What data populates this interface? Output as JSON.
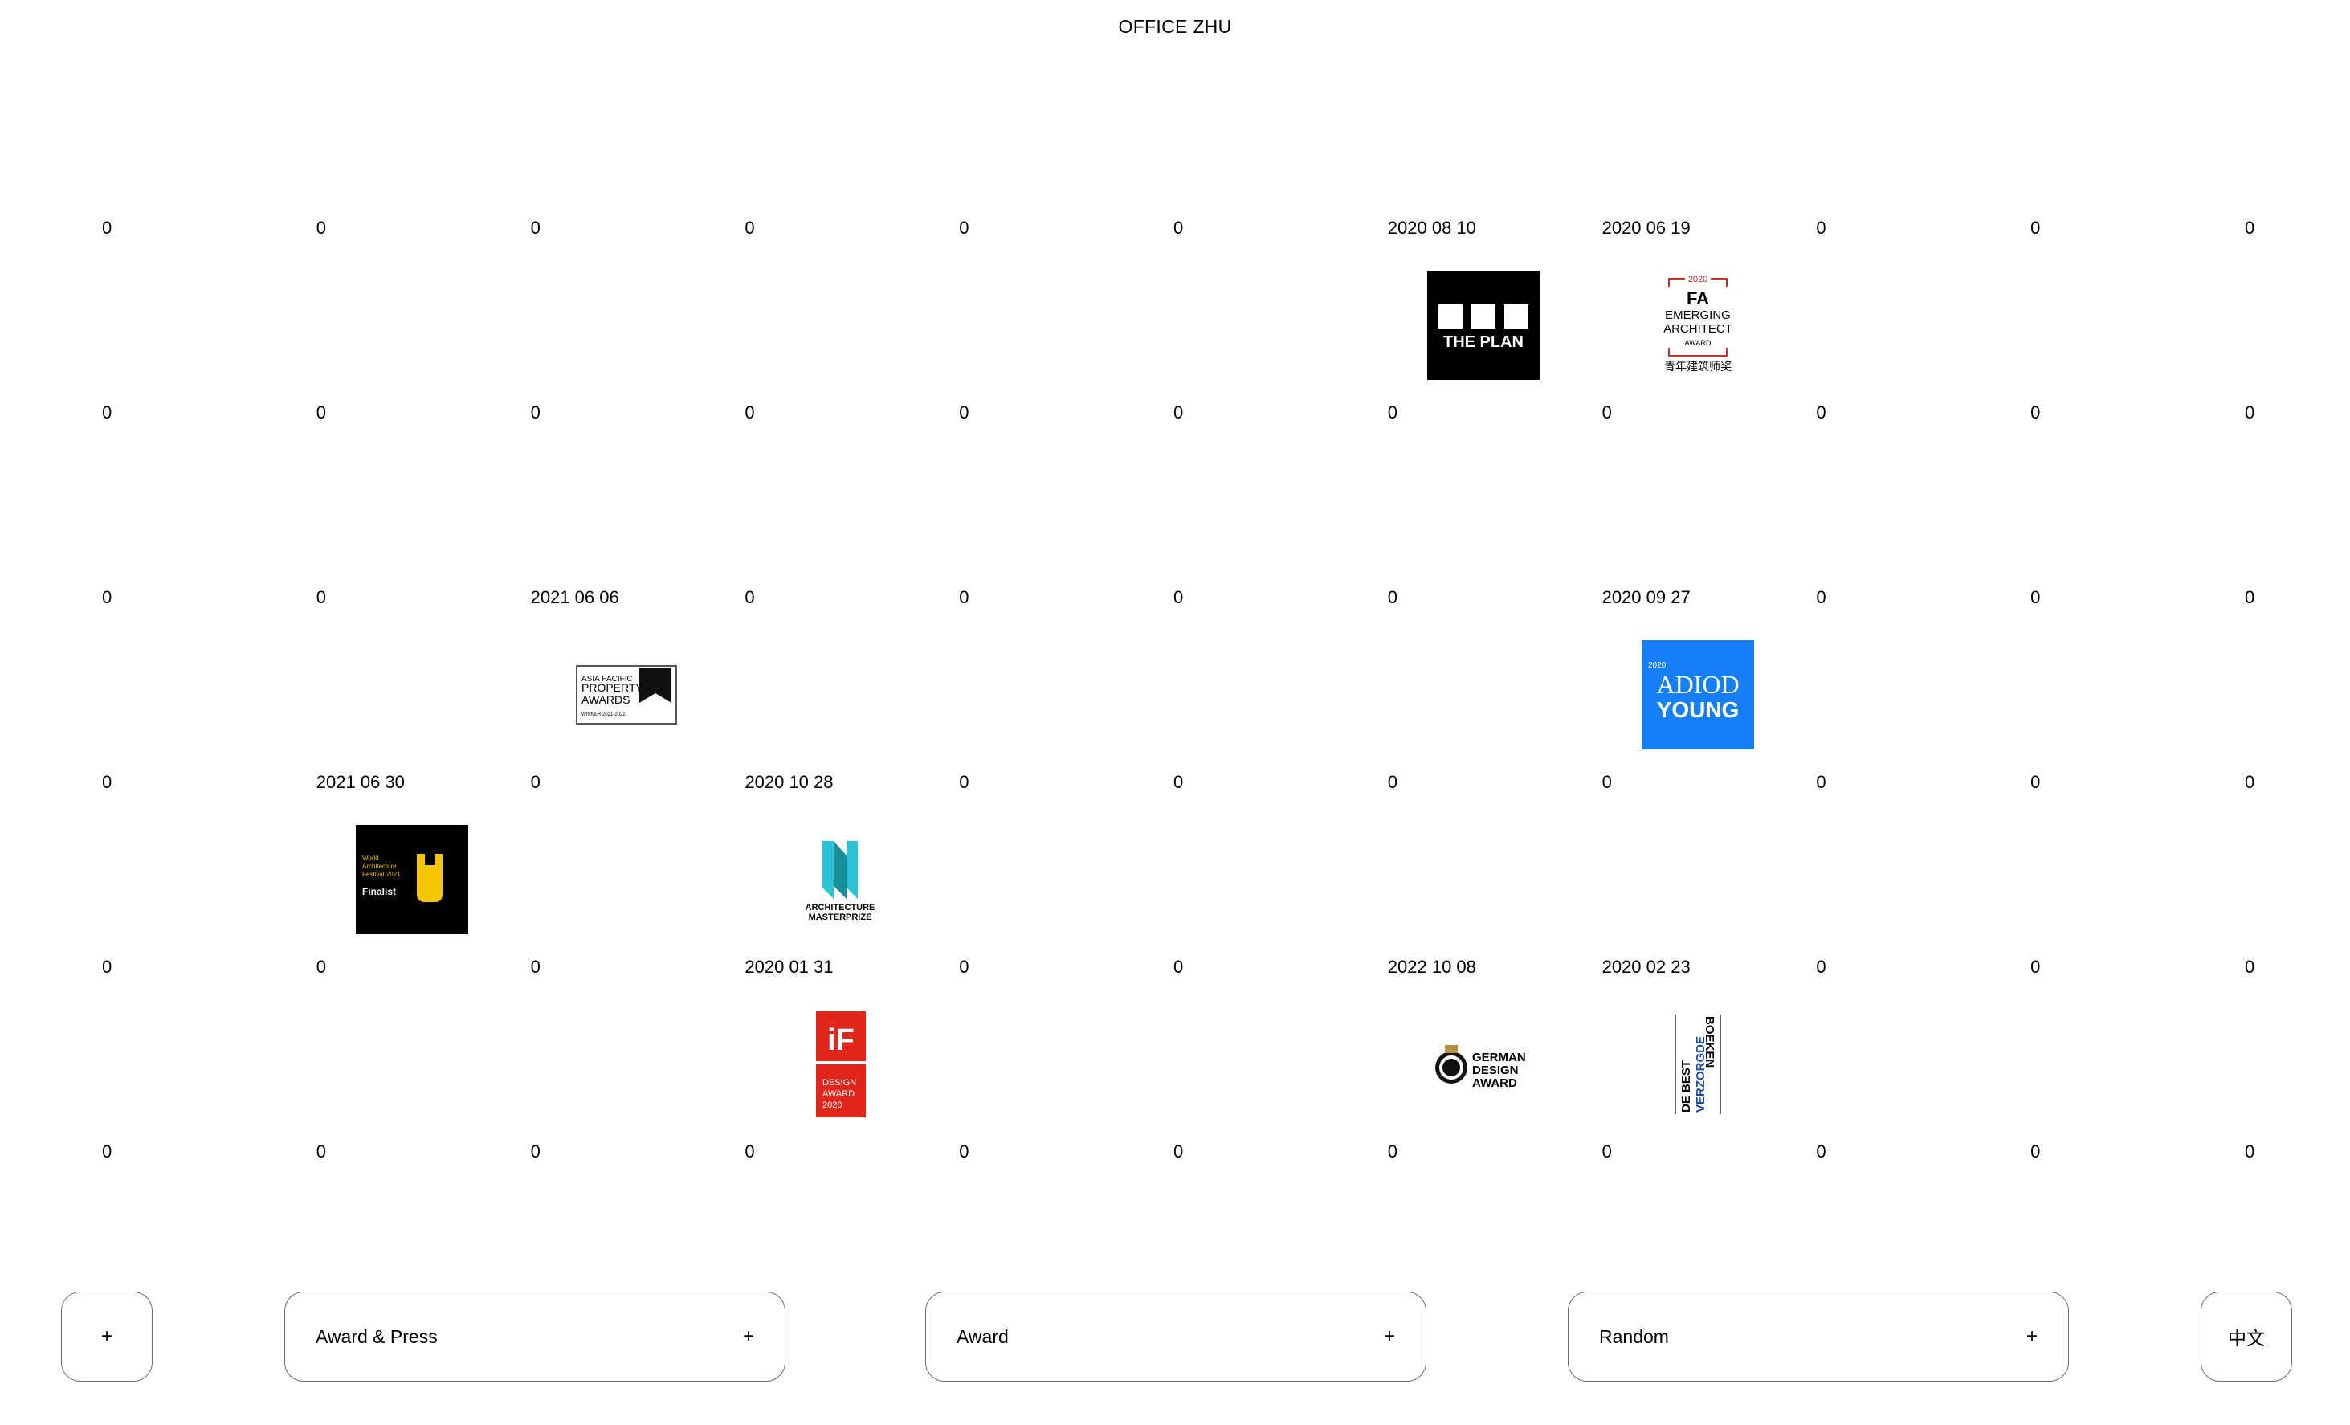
{
  "header": {
    "title": "OFFICE ZHU"
  },
  "grid": {
    "rows": [
      [
        "0",
        "0",
        "0",
        "0",
        "0",
        "0",
        "2020 08 10",
        "2020 06 19",
        "0",
        "0",
        "0"
      ],
      [
        "0",
        "0",
        "0",
        "0",
        "0",
        "0",
        "0",
        "0",
        "0",
        "0",
        "0"
      ],
      [
        "0",
        "0",
        "2021 06 06",
        "0",
        "0",
        "0",
        "0",
        "2020 09 27",
        "0",
        "0",
        "0"
      ],
      [
        "0",
        "2021 06 30",
        "0",
        "2020 10 28",
        "0",
        "0",
        "0",
        "0",
        "0",
        "0",
        "0"
      ],
      [
        "0",
        "0",
        "0",
        "2020 01 31",
        "0",
        "0",
        "2022 10 08",
        "2020 02 23",
        "0",
        "0",
        "0"
      ],
      [
        "0",
        "0",
        "0",
        "0",
        "0",
        "0",
        "0",
        "0",
        "0",
        "0",
        "0"
      ]
    ]
  },
  "logos": {
    "the_plan": {
      "text": "THE PLAN",
      "color": "#000000"
    },
    "fa_award": {
      "year": "2020",
      "line1": "FA",
      "line2": "EMERGING",
      "line3": "ARCHITECT",
      "line4": "AWARD",
      "line5": "青年建筑师奖",
      "accent": "#d02a2a"
    },
    "asia_pacific": {
      "line1": "ASIA PACIFIC",
      "line2": "PROPERTY",
      "line3": "AWARDS",
      "line4": "WINNER 2021-2022"
    },
    "adiod": {
      "year": "2020",
      "line1": "ADIOD",
      "line2": "YOUNG",
      "color": "#1580f5"
    },
    "waf": {
      "line1": "World",
      "line2": "Architecture",
      "line3": "Festival 2021",
      "line4": "Finalist",
      "accent": "#f7c600"
    },
    "amp": {
      "line1": "ARCHITECTURE",
      "line2": "MASTERPRIZE",
      "accent": "#2ac3d4"
    },
    "if_award": {
      "mark": "iF",
      "line1": "DESIGN",
      "line2": "AWARD",
      "line3": "2020",
      "color": "#e3261c"
    },
    "german_design": {
      "line1": "GERMAN",
      "line2": "DESIGN",
      "line3": "AWARD",
      "accent": "#b8903c"
    },
    "best_books": {
      "line1": "DE BEST",
      "line2": "VERZORGDE",
      "line3": "BOEKEN",
      "accent": "#1d4fa0"
    }
  },
  "footer": {
    "plus_button": "+",
    "award_press": {
      "label": "Award & Press",
      "plus": "+"
    },
    "award": {
      "label": "Award",
      "plus": "+"
    },
    "random": {
      "label": "Random",
      "plus": "+"
    },
    "language": "中文"
  }
}
